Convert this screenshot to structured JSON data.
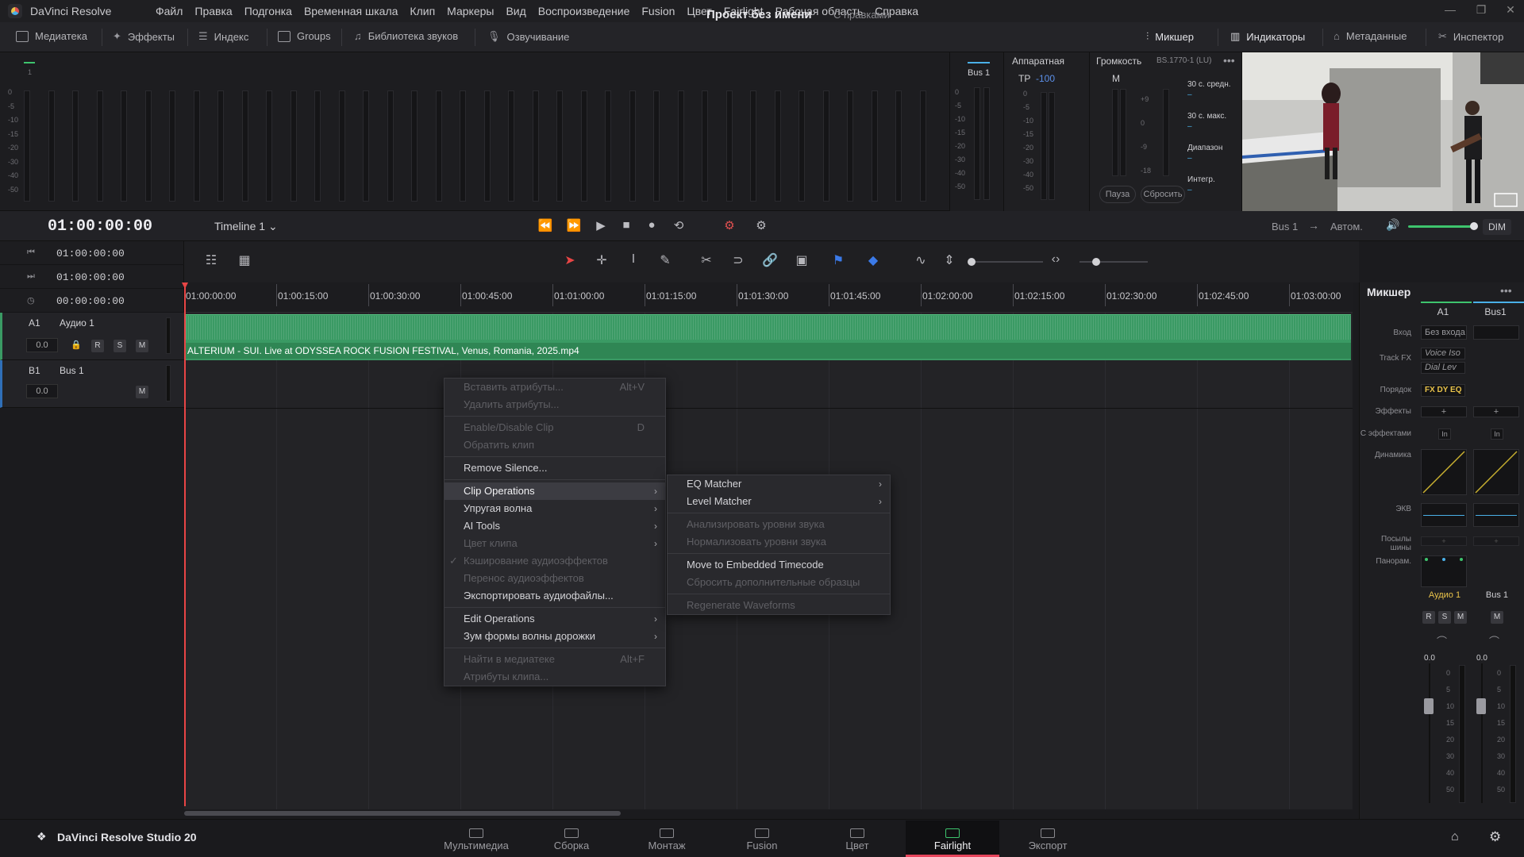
{
  "app": {
    "name": "DaVinci Resolve",
    "menu": [
      "Файл",
      "Правка",
      "Подгонка",
      "Временная шкала",
      "Клип",
      "Маркеры",
      "Вид",
      "Воспроизведение",
      "Fusion",
      "Цвет",
      "Fairlight",
      "Рабочая область",
      "Справка"
    ]
  },
  "toolbar": {
    "left": [
      "Медиатека",
      "Эффекты",
      "Индекс",
      "Groups",
      "Библиотека звуков",
      "Озвучивание"
    ],
    "project_title": "Проект без имени",
    "project_state": "С правками",
    "right": [
      "Микшер",
      "Индикаторы",
      "Метаданные",
      "Инспектор"
    ]
  },
  "meters": {
    "channel": "1",
    "scale": [
      "0",
      "-5",
      "-10",
      "-15",
      "-20",
      "-30",
      "-40",
      "-50"
    ],
    "bus_label": "Bus 1",
    "hw_label": "Аппаратная",
    "hw_tp_label": "TP",
    "hw_tp_value": "-100",
    "loudness_label": "Громкость",
    "loudness_std": "BS.1770-1 (LU)",
    "loudness_m": "M",
    "loudness_scale": [
      "+9",
      "0",
      "-9",
      "-18"
    ],
    "loudness_stats": [
      "30 с. средн.",
      "30 с. макс.",
      "Диапазон",
      "Интегр."
    ],
    "pause_btn": "Пауза",
    "reset_btn": "Сбросить"
  },
  "transport": {
    "timecode": "01:00:00:00",
    "timeline": "Timeline 1",
    "bus_out": "Bus 1",
    "auto": "Автом.",
    "dim": "DIM"
  },
  "tc_panel": [
    "01:00:00:00",
    "01:00:00:00",
    "00:00:00:00"
  ],
  "tracks": [
    {
      "tag": "A1",
      "name": "Аудио 1",
      "vol": "0.0",
      "btns": [
        "R",
        "S",
        "M"
      ]
    },
    {
      "tag": "B1",
      "name": "Bus 1",
      "vol": "0.0",
      "btns": [
        "M"
      ]
    }
  ],
  "ruler": [
    "01:00:00:00",
    "01:00:15:00",
    "01:00:30:00",
    "01:00:45:00",
    "01:01:00:00",
    "01:01:15:00",
    "01:01:30:00",
    "01:01:45:00",
    "01:02:00:00",
    "01:02:15:00",
    "01:02:30:00",
    "01:02:45:00",
    "01:03:00:00"
  ],
  "clip": {
    "name": "ALTERIUM  -  SUI. Live at ODYSSEA ROCK FUSION FESTIVAL, Venus, Romania, 2025.mp4"
  },
  "context_menu": {
    "items": [
      {
        "label": "Вставить атрибуты...",
        "shortcut": "Alt+V",
        "disabled": true
      },
      {
        "label": "Удалить атрибуты...",
        "disabled": true
      },
      {
        "sep": true
      },
      {
        "label": "Enable/Disable Clip",
        "shortcut": "D",
        "disabled": true
      },
      {
        "label": "Обратить клип",
        "disabled": true
      },
      {
        "sep": true
      },
      {
        "label": "Remove Silence..."
      },
      {
        "sep": true
      },
      {
        "label": "Clip Operations",
        "submenu": true,
        "highlight": true
      },
      {
        "label": "Упругая волна",
        "submenu": true
      },
      {
        "label": "AI Tools",
        "submenu": true
      },
      {
        "label": "Цвет клипа",
        "submenu": true,
        "disabled": true
      },
      {
        "label": "Кэширование аудиоэффектов",
        "checked": true,
        "disabled": true
      },
      {
        "label": "Перенос аудиоэффектов",
        "disabled": true
      },
      {
        "label": "Экспортировать аудиофайлы..."
      },
      {
        "sep": true
      },
      {
        "label": "Edit Operations",
        "submenu": true
      },
      {
        "label": "Зум формы волны дорожки",
        "submenu": true
      },
      {
        "sep": true
      },
      {
        "label": "Найти в медиатеке",
        "shortcut": "Alt+F",
        "disabled": true
      },
      {
        "label": "Атрибуты клипа...",
        "disabled": true
      }
    ],
    "submenu": [
      {
        "label": "EQ Matcher",
        "submenu": true
      },
      {
        "label": "Level Matcher",
        "submenu": true
      },
      {
        "sep": true
      },
      {
        "label": "Анализировать уровни звука",
        "disabled": true
      },
      {
        "label": "Нормализовать уровни звука",
        "disabled": true
      },
      {
        "sep": true
      },
      {
        "label": "Move to Embedded Timecode"
      },
      {
        "label": "Сбросить дополнительные образцы",
        "disabled": true
      },
      {
        "sep": true
      },
      {
        "label": "Regenerate Waveforms",
        "disabled": true
      }
    ]
  },
  "mixer": {
    "title": "Микшер",
    "channels": [
      "A1",
      "Bus1"
    ],
    "labels": [
      "Вход",
      "Track FX",
      "Порядок",
      "Эффекты",
      "С эффектами",
      "Динамика",
      "ЭКВ",
      "Посылы шины",
      "Панорам."
    ],
    "input_value": "Без входа",
    "fx": [
      "Voice Iso",
      "Dial Lev"
    ],
    "order": "FX DY EQ",
    "add": "+",
    "in": "In",
    "strip_names": [
      "Аудио 1",
      "Bus 1"
    ],
    "fader_values": [
      "0.0",
      "0.0"
    ],
    "fader_scale": [
      "0",
      "5",
      "10",
      "15",
      "20",
      "30",
      "40",
      "50"
    ]
  },
  "pages": {
    "brand": "DaVinci Resolve Studio 20",
    "items": [
      "Мультимедиа",
      "Сборка",
      "Монтаж",
      "Fusion",
      "Цвет",
      "Fairlight",
      "Экспорт"
    ],
    "active": "Fairlight"
  },
  "colors": {
    "accent_green": "#3a9a64",
    "playhead": "#e84545",
    "active_page": "#e8455c"
  }
}
